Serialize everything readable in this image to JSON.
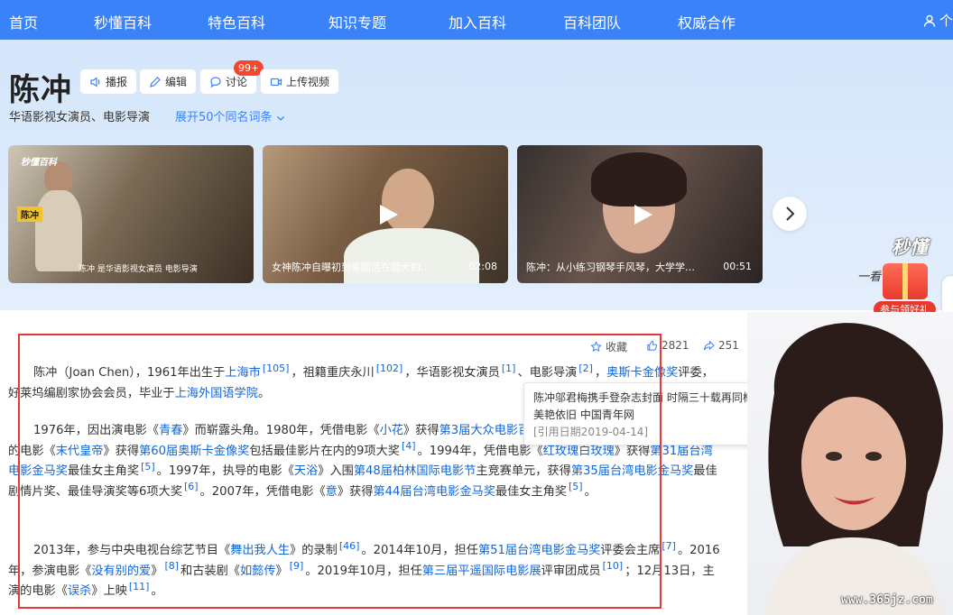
{
  "nav": {
    "items": [
      "首页",
      "秒懂百科",
      "特色百科",
      "知识专题",
      "加入百科",
      "百科团队",
      "权威合作"
    ],
    "user_label": "个"
  },
  "header": {
    "title": "陈冲",
    "actions": {
      "broadcast": "播报",
      "edit": "编辑",
      "discuss": "讨论",
      "upload": "上传视频"
    },
    "discuss_badge": "99+",
    "subtitle": "华语影视女演员、电影导演",
    "expand_link": "展开50个同名词条"
  },
  "videos": [
    {
      "caption": "陈冲 是华语影视女演员 电影导演",
      "logo": "秒懂百科",
      "tag": "陈冲",
      "duration": ""
    },
    {
      "caption": "女神陈冲自曝初到美国活在挺大的…",
      "duration": "02:08"
    },
    {
      "caption": "陈冲：从小练习钢琴手风琴，大学学…",
      "duration": "00:51"
    }
  ],
  "promo": {
    "logo": "秒懂",
    "line": "一看 … 视",
    "pill": "参与领好礼"
  },
  "tools": {
    "favorite": "收藏",
    "like_count": "2821",
    "share_count": "251"
  },
  "article": {
    "p1": [
      {
        "t": "陈冲（Joan Chen），1961年出生于"
      },
      {
        "t": "上海市",
        "link": true
      },
      {
        "t": "[105]",
        "ref": true
      },
      {
        "t": "，祖籍重庆永川"
      },
      {
        "t": "[102]",
        "ref": true
      },
      {
        "t": "，华语影视女演员"
      },
      {
        "t": "[1]",
        "ref": true
      },
      {
        "t": "、电影导演"
      },
      {
        "t": "[2]",
        "ref": true
      },
      {
        "t": "，"
      },
      {
        "t": "奥斯卡金像奖",
        "link": true
      },
      {
        "t": "评委，好莱坞编剧家协会会员，毕业于"
      },
      {
        "t": "上海外国语学院",
        "link": true
      },
      {
        "t": "。"
      }
    ],
    "p2": [
      {
        "t": "1976年，因出演电影《"
      },
      {
        "t": "青春",
        "link": true
      },
      {
        "t": "》而崭露头角。1980年，凭借电影《"
      },
      {
        "t": "小花",
        "link": true
      },
      {
        "t": "》获得"
      },
      {
        "t": "第3届大众电影百花奖",
        "link": true
      },
      {
        "t": "最佳女演员奖；1988年，主演的电影《"
      },
      {
        "t": "末代皇帝",
        "link": true
      },
      {
        "t": "》获得"
      },
      {
        "t": "第60届奥斯卡金像奖",
        "link": true
      },
      {
        "t": "包括最佳影片在内的9项大奖"
      },
      {
        "t": "[4]",
        "ref": true
      },
      {
        "t": "。1994年，凭借电影《"
      },
      {
        "t": "红玫瑰白玫瑰",
        "link": true
      },
      {
        "t": "》获得"
      },
      {
        "t": "第31届台湾电影金马奖",
        "link": true
      },
      {
        "t": "最佳女主角奖"
      },
      {
        "t": "[5]",
        "ref": true
      },
      {
        "t": "。1997年，执导的电影《"
      },
      {
        "t": "天浴",
        "link": true
      },
      {
        "t": "》入围"
      },
      {
        "t": "第48届柏林国际电影节",
        "link": true
      },
      {
        "t": "主竞赛单元，获得"
      },
      {
        "t": "第35届台湾电影金马奖",
        "link": true
      },
      {
        "t": "最佳剧情片奖、最佳导演奖等6项大奖"
      },
      {
        "t": "[6]",
        "ref": true
      },
      {
        "t": "。2007年，凭借电影《"
      },
      {
        "t": "意",
        "link": true
      },
      {
        "t": "》获得"
      },
      {
        "t": "第44届台湾电影金马奖",
        "link": true
      },
      {
        "t": "最佳女主角奖"
      },
      {
        "t": "[5]",
        "ref": true
      },
      {
        "t": "。"
      }
    ],
    "p3": [
      {
        "t": "2013年，参与中央电视台综艺节目《"
      },
      {
        "t": "舞出我人生",
        "link": true
      },
      {
        "t": "》的录制"
      },
      {
        "t": "[46]",
        "ref": true
      },
      {
        "t": "。2014年10月，担任"
      },
      {
        "t": "第51届台湾电影金马奖",
        "link": true
      },
      {
        "t": "评委会主席"
      },
      {
        "t": "[7]",
        "ref": true
      },
      {
        "t": "。2016年，参演电影《"
      },
      {
        "t": "没有别的爱",
        "link": true
      },
      {
        "t": "》"
      },
      {
        "t": "[8]",
        "ref": true
      },
      {
        "t": "和古装剧《"
      },
      {
        "t": "如懿传",
        "link": true
      },
      {
        "t": "》"
      },
      {
        "t": "[9]",
        "ref": true
      },
      {
        "t": "。2019年10月，担任"
      },
      {
        "t": "第三届平遥国际电影展",
        "link": true
      },
      {
        "t": "评审团成员"
      },
      {
        "t": "[10]",
        "ref": true
      },
      {
        "t": "；12月13日，主演的电影《"
      },
      {
        "t": "误杀",
        "link": true
      },
      {
        "t": "》上映"
      },
      {
        "t": "[11]",
        "ref": true
      },
      {
        "t": "。"
      }
    ]
  },
  "tooltip": {
    "text": "陈冲邬君梅携手登杂志封面 时隔三十载再同框美艳依旧 中国青年网",
    "date": "[引用日期2019-04-14]"
  },
  "watermark": "www.365jz.com",
  "colors": {
    "nav": "#3a82f8",
    "link": "#1367d4",
    "highlight": "#e53935"
  }
}
